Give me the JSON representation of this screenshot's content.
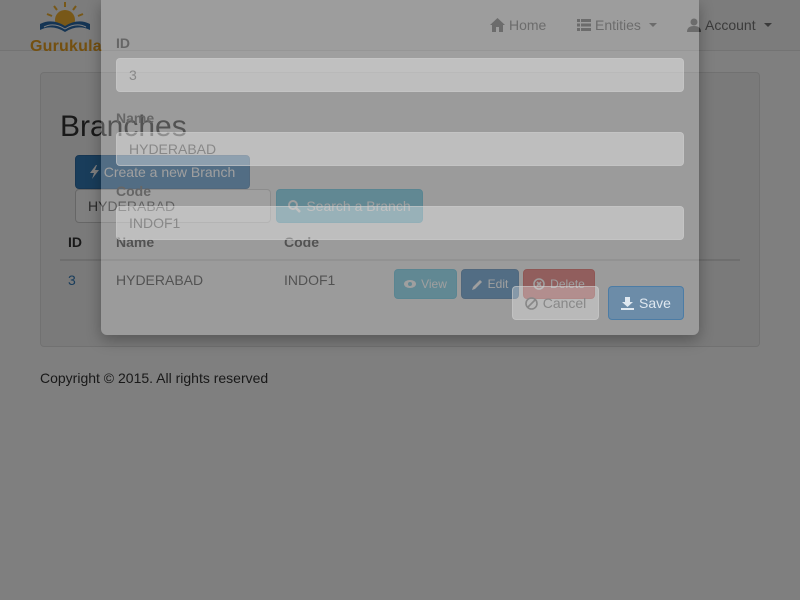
{
  "navbar": {
    "brand": "Gurukula",
    "home_label": "Home",
    "entities_label": "Entities",
    "account_label": "Account"
  },
  "page": {
    "title": "Branches",
    "create_label": "Create a new Branch",
    "search_value": "HYDERABAD",
    "search_button_label": "Search a Branch"
  },
  "table": {
    "headers": [
      "ID",
      "Name",
      "Code"
    ],
    "rows": [
      {
        "id": "3",
        "name": "HYDERABAD",
        "code": "INDOF1"
      }
    ],
    "view_label": "View",
    "edit_label": "Edit",
    "delete_label": "Delete"
  },
  "footer": {
    "text": "Copyright © 2015. All rights reserved"
  },
  "modal": {
    "id_label": "ID",
    "id_value": "3",
    "name_label": "Name",
    "name_value": "HYDERABAD",
    "code_label": "Code",
    "code_value": "INDOF1",
    "cancel_label": "Cancel",
    "save_label": "Save"
  },
  "colors": {
    "primary": "#337ab7",
    "info": "#5bc0de",
    "danger": "#d9534f",
    "brand": "#e8a020"
  }
}
